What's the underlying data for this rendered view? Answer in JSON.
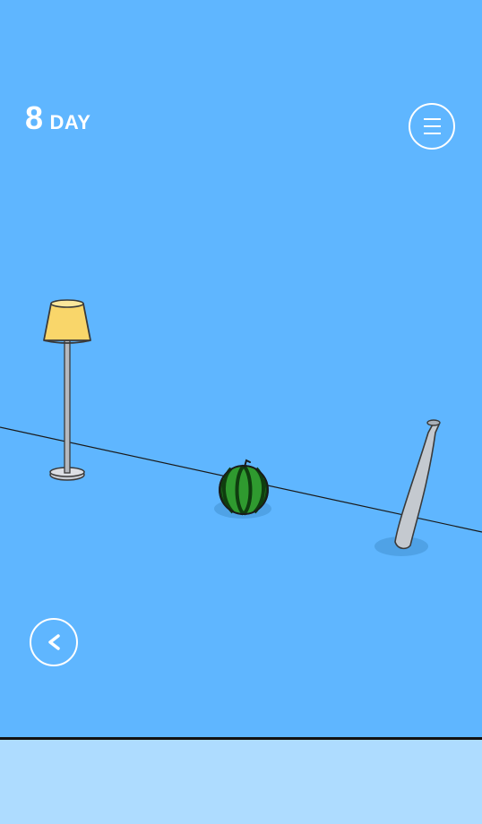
{
  "hud": {
    "day_number": "8",
    "day_label": "DAY"
  },
  "icons": {
    "menu": "hamburger-menu-icon",
    "back": "chevron-left-icon"
  },
  "scene": {
    "items": [
      "floor-lamp",
      "watermelon",
      "baseball-bat"
    ]
  },
  "colors": {
    "sky": "#5fb6ff",
    "bottom_panel": "#aedcff",
    "lamp_shade": "#f9d66a",
    "watermelon_green": "#2f9a2f",
    "bat_gray": "#c4c9cf"
  }
}
